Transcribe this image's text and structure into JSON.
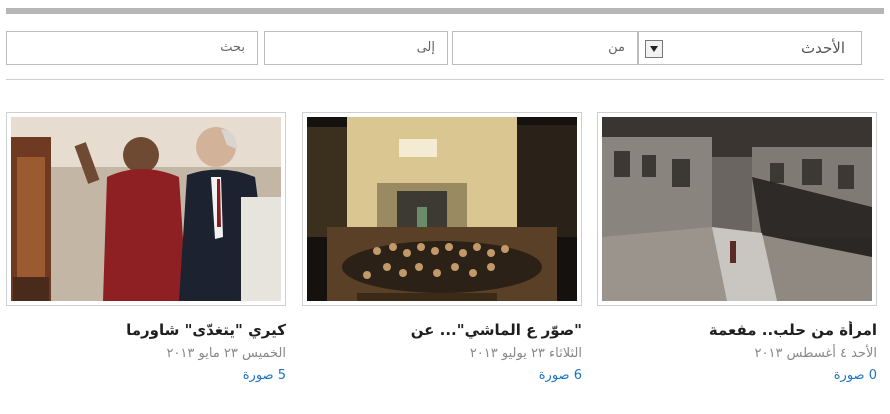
{
  "filters": {
    "sort_selected": "الأحدث",
    "from_placeholder": "من",
    "to_placeholder": "إلى",
    "search_placeholder": "بحث"
  },
  "gallery": {
    "items": [
      {
        "title": "امرأة من حلب.. مفعمة",
        "date": "الأحد ٤ أغسطس ٢٠١٣",
        "count": "0 صورة"
      },
      {
        "title": "\"صوّر ع الماشي\"... عن",
        "date": "الثلاثاء ٢٣ يوليو ٢٠١٣",
        "count": "6 صورة"
      },
      {
        "title": "كيري \"يتغدّى\" شاورما",
        "date": "الخميس ٢٣ مايو ٢٠١٣",
        "count": "5 صورة"
      }
    ]
  }
}
